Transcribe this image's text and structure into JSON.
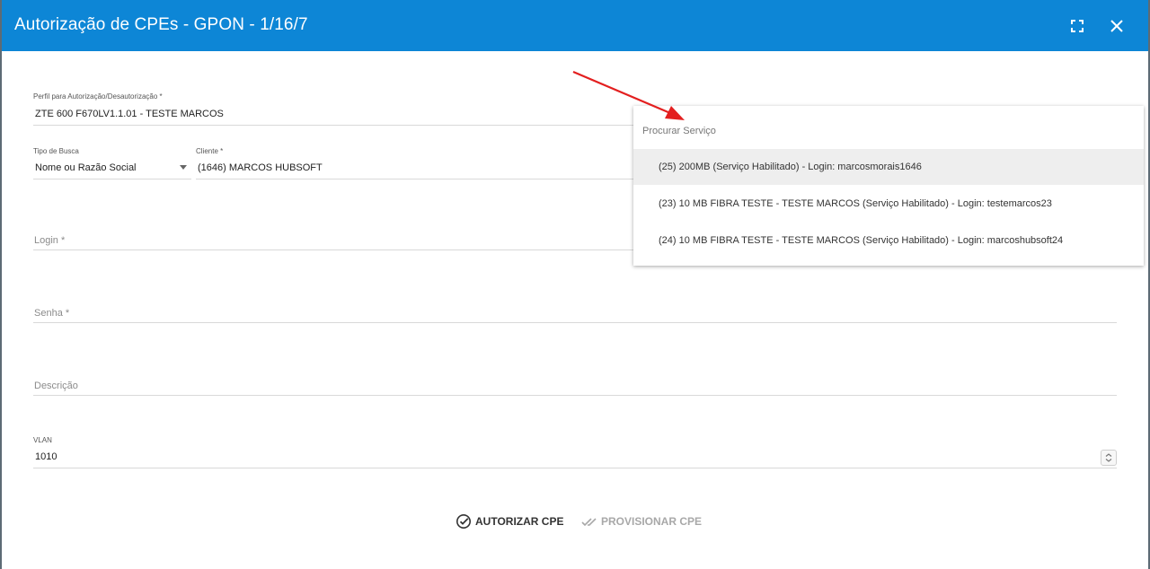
{
  "dialog": {
    "title": "Autorização de CPEs - GPON - 1/16/7"
  },
  "form": {
    "perfil": {
      "label": "Perfil para Autorização/Desautorização *",
      "value": "ZTE 600 F670LV1.1.01 - TESTE MARCOS"
    },
    "tipo_busca": {
      "label": "Tipo de Busca",
      "value": "Nome ou Razão Social"
    },
    "cliente": {
      "label": "Cliente *",
      "value": "(1646) MARCOS HUBSOFT"
    },
    "login": {
      "placeholder": "Login *"
    },
    "senha": {
      "placeholder": "Senha *"
    },
    "descricao": {
      "placeholder": "Descrição"
    },
    "vlan": {
      "label": "VLAN",
      "value": "1010"
    }
  },
  "dropdown": {
    "search_placeholder": "Procurar Serviço",
    "options": [
      "(25) 200MB (Serviço Habilitado) - Login: marcosmorais1646",
      "(23) 10 MB FIBRA TESTE - TESTE MARCOS (Serviço Habilitado) - Login: testemarcos23",
      "(24) 10 MB FIBRA TESTE - TESTE MARCOS (Serviço Habilitado) - Login: marcoshubsoft24"
    ]
  },
  "actions": {
    "authorize": "AUTORIZAR CPE",
    "provision": "PROVISIONAR CPE"
  },
  "colors": {
    "titlebar": "#0d86d6",
    "annotation_arrow": "#e31f1f",
    "disabled_text": "#a8a8a8"
  },
  "icons": [
    "fullscreen-icon",
    "close-icon",
    "dropdown-caret-icon",
    "check-circle-icon",
    "double-check-icon",
    "number-spinner-icon"
  ]
}
